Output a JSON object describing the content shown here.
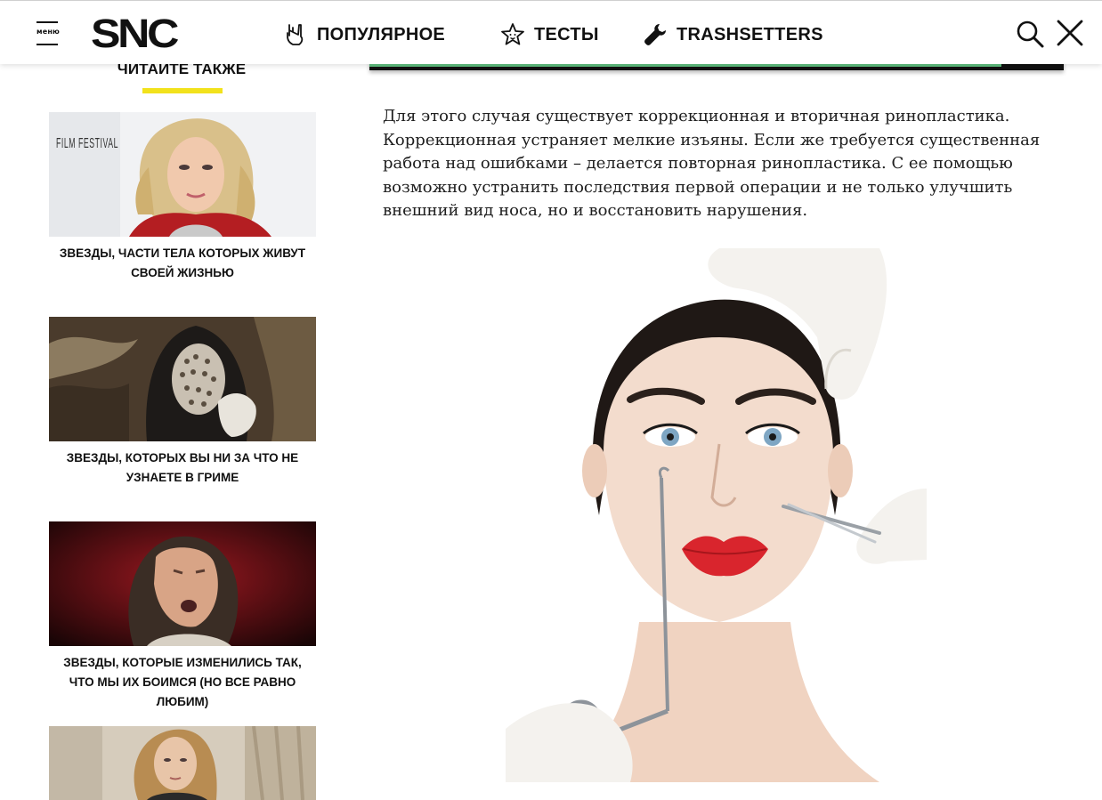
{
  "header": {
    "menu_label": "меню",
    "logo_text": "SNC",
    "nav": [
      {
        "label": "ПОПУЛЯРНОЕ",
        "icon": "rock-hand-icon"
      },
      {
        "label": "ТЕСТЫ",
        "icon": "star-icon"
      },
      {
        "label": "TRASHSETTERS",
        "icon": "wrench-icon"
      }
    ],
    "search_icon": "search-icon",
    "close_icon": "close-icon"
  },
  "sidebar": {
    "title": "ЧИТАЙТЕ ТАКЖЕ",
    "accent_color": "#f2e21c",
    "cards": [
      {
        "caption": "ЗВЕЗДЫ, ЧАСТИ ТЕЛА КОТОРЫХ ЖИВУТ СВОЕЙ ЖИЗНЬЮ",
        "image_text": "FILM FESTIVAL"
      },
      {
        "caption": "ЗВЕЗДЫ, КОТОРЫХ ВЫ НИ ЗА ЧТО НЕ УЗНАЕТЕ В ГРИМЕ"
      },
      {
        "caption": "ЗВЕЗДЫ, КОТОРЫЕ ИЗМЕНИЛИСЬ ТАК, ЧТО МЫ ИХ БОИМСЯ (НО ВСЕ РАВНО ЛЮБИМ)"
      },
      {
        "caption": ""
      }
    ]
  },
  "main": {
    "progress_accent_color": "#5fbf7e",
    "paragraph": "Для этого случая существует коррекционная и вторичная ринопластика. Коррекционная устраняет мелкие изъяны. Если же требуется существенная работа над ошибками – делается повторная ринопластика. С ее помощью возможно устранить последствия первой операции и не только улучшить внешний вид носа, но и восстановить нарушения."
  }
}
